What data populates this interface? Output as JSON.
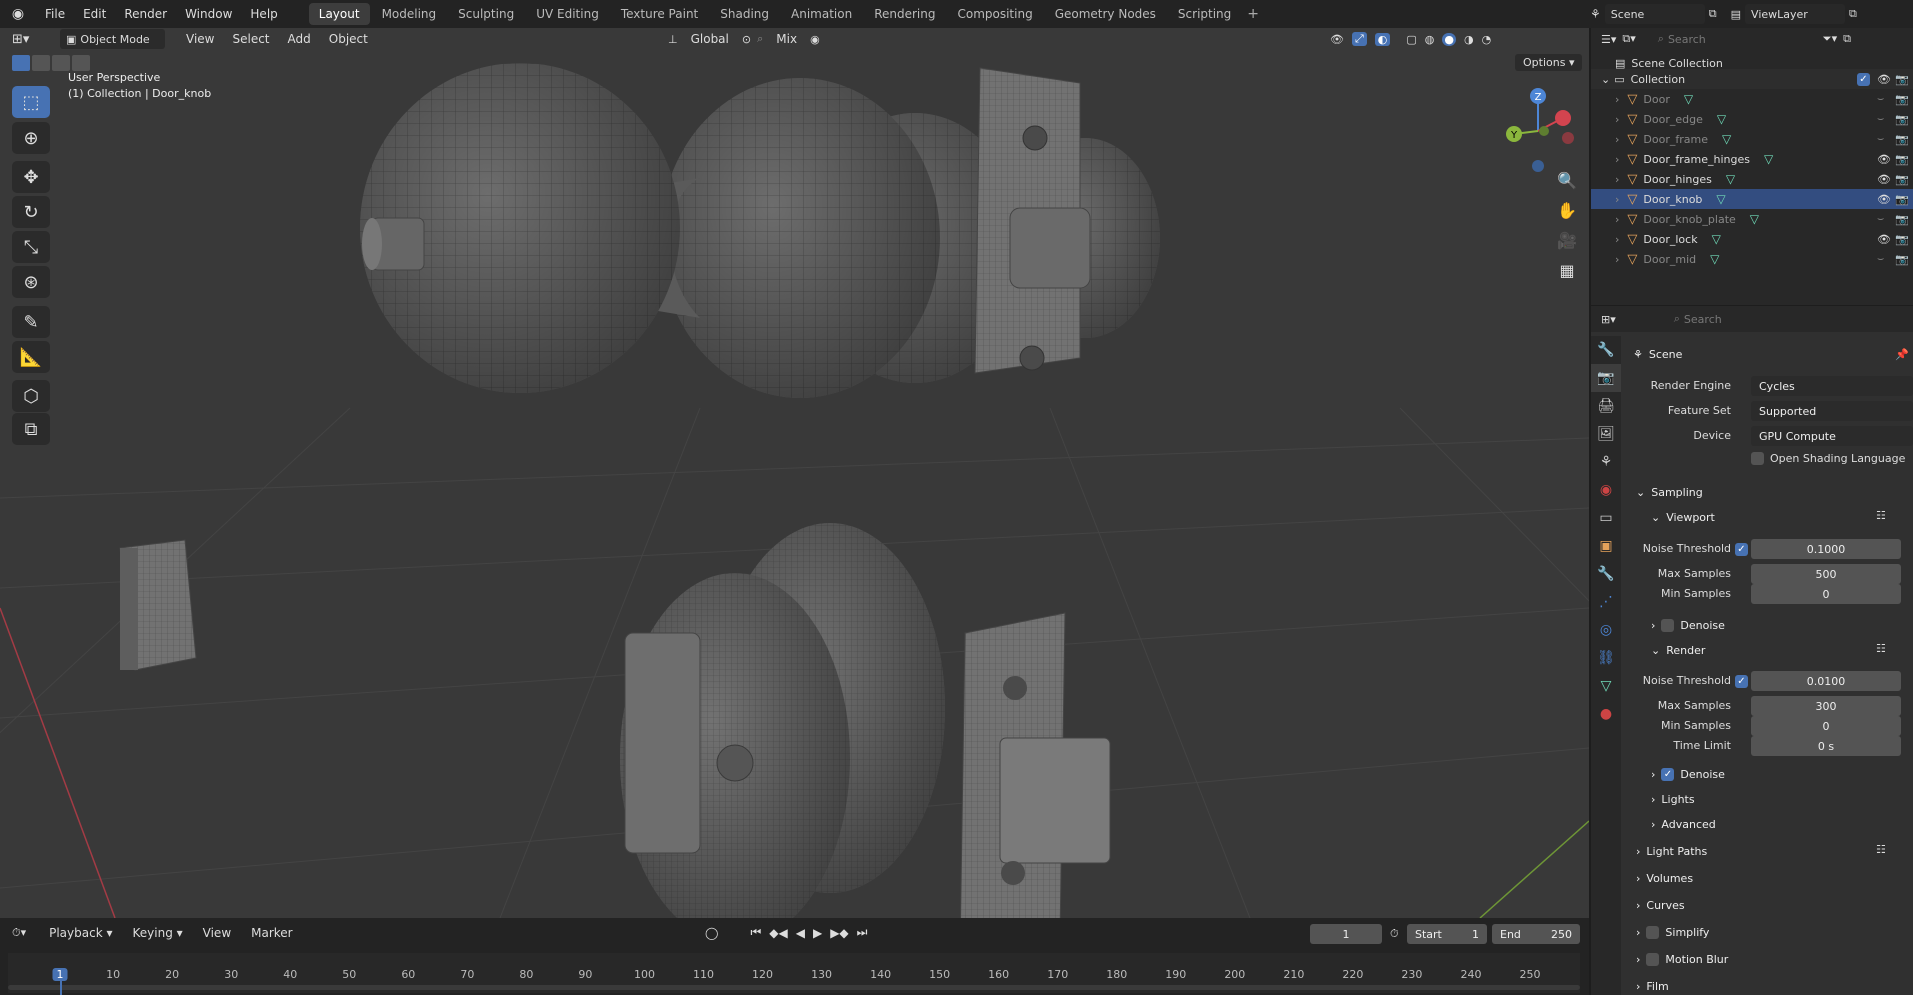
{
  "topbar": {
    "menus": [
      "File",
      "Edit",
      "Render",
      "Window",
      "Help"
    ],
    "workspaces": [
      "Layout",
      "Modeling",
      "Sculpting",
      "UV Editing",
      "Texture Paint",
      "Shading",
      "Animation",
      "Rendering",
      "Compositing",
      "Geometry Nodes",
      "Scripting"
    ],
    "active_workspace": "Layout",
    "scene": "Scene",
    "view_layer": "ViewLayer"
  },
  "viewport": {
    "mode": "Object Mode",
    "menus": [
      "View",
      "Select",
      "Add",
      "Object"
    ],
    "transform_orientation": "Global",
    "snap_mode": "Mix",
    "options_label": "Options",
    "perspective_label": "User Perspective",
    "collection_label": "(1) Collection | Door_knob",
    "gizmo": {
      "x": "X",
      "y": "Y",
      "z": "Z"
    }
  },
  "outliner": {
    "search_placeholder": "Search",
    "root": "Scene Collection",
    "collection": "Collection",
    "items": [
      {
        "name": "Door",
        "visible": false
      },
      {
        "name": "Door_edge",
        "visible": false
      },
      {
        "name": "Door_frame",
        "visible": false
      },
      {
        "name": "Door_frame_hinges",
        "visible": true
      },
      {
        "name": "Door_hinges",
        "visible": true
      },
      {
        "name": "Door_knob",
        "visible": true
      },
      {
        "name": "Door_knob_plate",
        "visible": false
      },
      {
        "name": "Door_lock",
        "visible": true
      },
      {
        "name": "Door_mid",
        "visible": false
      }
    ]
  },
  "properties": {
    "search_placeholder": "Search",
    "context": "Scene",
    "render_engine_label": "Render Engine",
    "render_engine": "Cycles",
    "feature_set_label": "Feature Set",
    "feature_set": "Supported",
    "device_label": "Device",
    "device": "GPU Compute",
    "osl_label": "Open Shading Language",
    "sampling": "Sampling",
    "viewport_section": "Viewport",
    "noise_threshold_label": "Noise Threshold",
    "max_samples_label": "Max Samples",
    "min_samples_label": "Min Samples",
    "time_limit_label": "Time Limit",
    "viewport_noise_threshold": "0.1000",
    "viewport_max_samples": "500",
    "viewport_min_samples": "0",
    "denoise_label": "Denoise",
    "render_section": "Render",
    "render_noise_threshold": "0.0100",
    "render_max_samples": "300",
    "render_min_samples": "0",
    "render_time_limit": "0 s",
    "lights": "Lights",
    "advanced": "Advanced",
    "light_paths": "Light Paths",
    "volumes": "Volumes",
    "curves": "Curves",
    "simplify": "Simplify",
    "motion_blur": "Motion Blur",
    "film": "Film"
  },
  "timeline": {
    "menus": [
      "Playback",
      "Keying",
      "View",
      "Marker"
    ],
    "current_frame": "1",
    "start_label": "Start",
    "start": "1",
    "end_label": "End",
    "end": "250",
    "ticks": [
      "1",
      "10",
      "20",
      "30",
      "40",
      "50",
      "60",
      "70",
      "80",
      "90",
      "100",
      "110",
      "120",
      "130",
      "140",
      "150",
      "160",
      "170",
      "180",
      "190",
      "200",
      "210",
      "220",
      "230",
      "240",
      "250"
    ]
  },
  "colors": {
    "accent": "#4772b3",
    "mesh_icon": "#e4a25b",
    "data_icon": "#6fd9b7",
    "x_axis": "#d3444f",
    "y_axis": "#8bb73d",
    "z_axis": "#4d86d6"
  }
}
